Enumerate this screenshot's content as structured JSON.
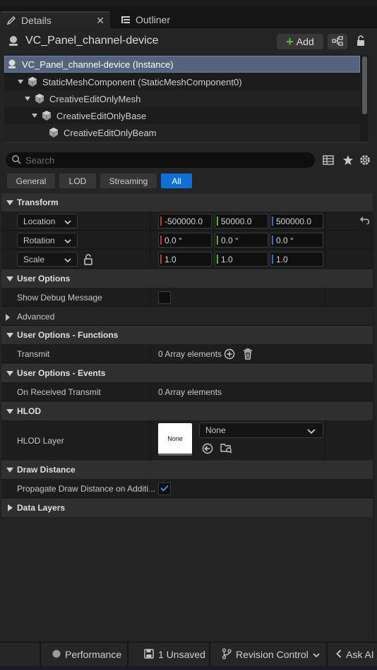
{
  "tabs": {
    "details": {
      "label": "Details",
      "icon": "pencil-icon"
    },
    "outliner": {
      "label": "Outliner",
      "icon": "outliner-list-icon"
    }
  },
  "header": {
    "actor_name": "VC_Panel_channel-device",
    "add_label": "Add",
    "add_icon": "plus-icon"
  },
  "component_tree": [
    {
      "label": "VC_Panel_channel-device (Instance)",
      "selected": true,
      "depth": 0
    },
    {
      "label": "StaticMeshComponent (StaticMeshComponent0)",
      "depth": 1
    },
    {
      "label": "CreativeEditOnlyMesh",
      "depth": 2
    },
    {
      "label": "CreativeEditOnlyBase",
      "depth": 3
    },
    {
      "label": "CreativeEditOnlyBeam",
      "depth": 4
    }
  ],
  "search": {
    "placeholder": "Search"
  },
  "filters": [
    "General",
    "LOD",
    "Streaming",
    "All"
  ],
  "active_filter": "All",
  "sections": {
    "transform": "Transform",
    "user_options": "User Options",
    "advanced": "Advanced",
    "user_options_functions": "User Options - Functions",
    "user_options_events": "User Options - Events",
    "hlod": "HLOD",
    "draw_distance": "Draw Distance",
    "data_layers": "Data Layers"
  },
  "transform": {
    "location": {
      "label": "Location",
      "x": "-500000.0",
      "y": "50000.0",
      "z": "500000.0"
    },
    "rotation": {
      "label": "Rotation",
      "x": "0.0 °",
      "y": "0.0 °",
      "z": "0.0 °"
    },
    "scale": {
      "label": "Scale",
      "x": "1.0",
      "y": "1.0",
      "z": "1.0"
    }
  },
  "user_options": {
    "show_debug_label": "Show Debug Message",
    "show_debug_checked": false
  },
  "functions": {
    "transmit_label": "Transmit",
    "transmit_value": "0 Array elements"
  },
  "events": {
    "on_received_label": "On Received Transmit",
    "on_received_value": "0 Array elements"
  },
  "hlod": {
    "layer_label": "HLOD Layer",
    "thumb_text": "None",
    "combo_value": "None"
  },
  "draw_distance": {
    "propagate_label": "Propagate Draw Distance on Additi...",
    "propagate_checked": true
  },
  "statusbar": {
    "performance": "Performance",
    "unsaved": "1 Unsaved",
    "revision_control": "Revision Control",
    "ask_ai": "Ask AI"
  },
  "colors": {
    "accent_blue": "#0f6fd6",
    "axis_x": "#c8352b",
    "axis_y": "#5db02c",
    "axis_z": "#2f6fd8",
    "selection": "#53647c"
  }
}
